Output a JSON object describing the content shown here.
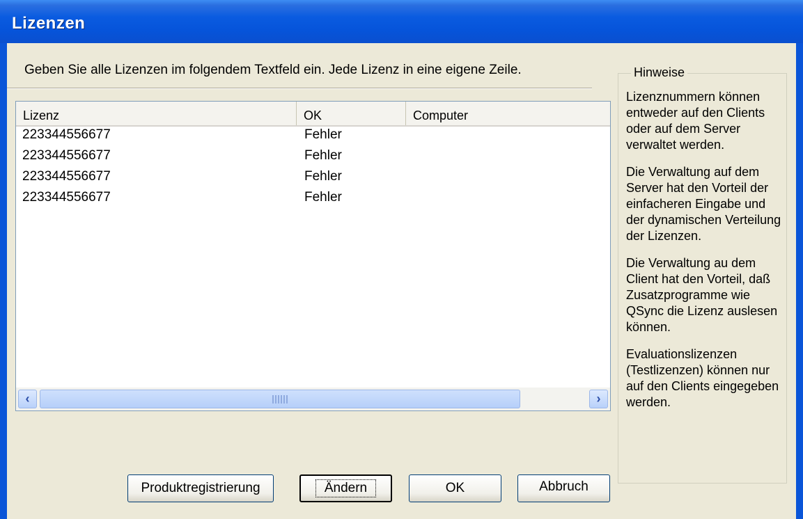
{
  "window": {
    "title": "Lizenzen"
  },
  "instruction": "Geben Sie alle Lizenzen im folgendem Textfeld ein. Jede Lizenz in eine eigene Zeile.",
  "table": {
    "columns": [
      "Lizenz",
      "OK",
      "Computer"
    ],
    "rows": [
      {
        "lizenz": "223344556677",
        "ok": "Fehler",
        "computer": ""
      },
      {
        "lizenz": "223344556677",
        "ok": "Fehler",
        "computer": ""
      },
      {
        "lizenz": "223344556677",
        "ok": "Fehler",
        "computer": ""
      },
      {
        "lizenz": "223344556677",
        "ok": "Fehler",
        "computer": ""
      }
    ]
  },
  "hints": {
    "legend": "Hinweise",
    "paragraphs": [
      "Lizenznummern können entweder auf den Clients oder auf dem Server verwaltet werden.",
      "Die Verwaltung auf dem Server hat den Vorteil der einfacheren Eingabe und der dynamischen Verteilung der Lizenzen.",
      "Die Verwaltung au dem Client hat den Vorteil, daß Zusatzprogramme wie QSync die Lizenz auslesen können.",
      "Evaluationslizenzen (Testlizenzen) können nur auf den Clients eingegeben werden."
    ]
  },
  "buttons": {
    "register": "Produktregistrierung",
    "change": "Ändern",
    "ok": "OK",
    "cancel": "Abbruch"
  },
  "colors": {
    "titlebar": "#0a5be0",
    "dialog_bg": "#ece9d8",
    "scroll_thumb": "#b6cff9"
  },
  "icons": {
    "scroll_left": "chevron-left-icon",
    "scroll_right": "chevron-right-icon"
  }
}
